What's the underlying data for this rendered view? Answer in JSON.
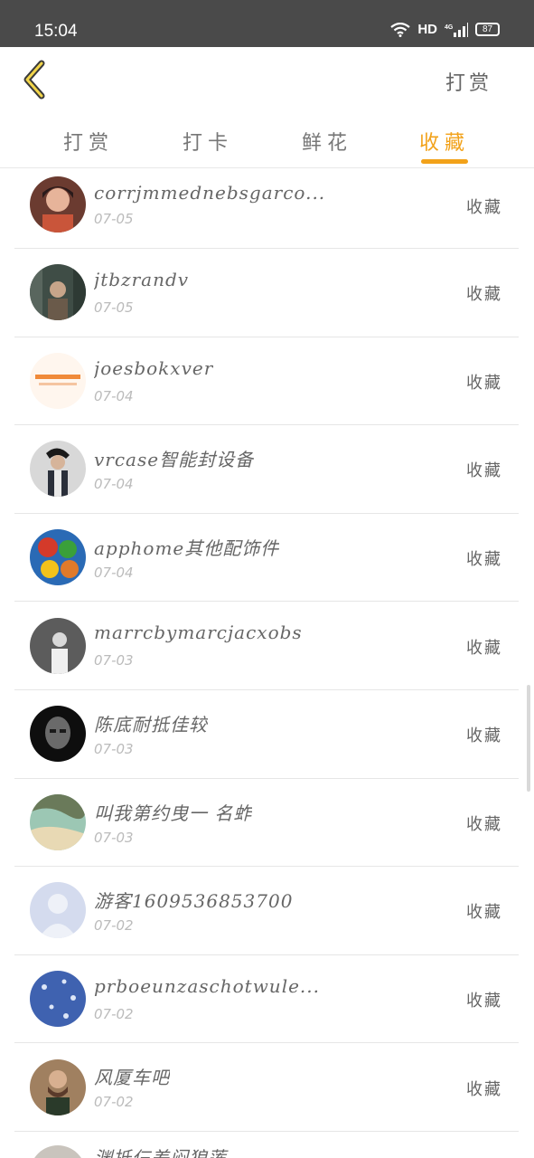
{
  "status_bar": {
    "time": "15:04",
    "network": "HD",
    "signal": "4G",
    "battery": "87"
  },
  "header": {
    "action_label": "打赏"
  },
  "tabs": [
    {
      "label": "打赏",
      "active": false
    },
    {
      "label": "打卡",
      "active": false
    },
    {
      "label": "鲜花",
      "active": false
    },
    {
      "label": "收藏",
      "active": true
    }
  ],
  "items": [
    {
      "name": "corrjmmednebsgarco...",
      "date": "07-05",
      "tag": "收藏",
      "avatar_color": "#7a4a3a"
    },
    {
      "name": "jtbzrandv",
      "date": "07-05",
      "tag": "收藏",
      "avatar_color": "#4c5a52"
    },
    {
      "name": "joesbokxver",
      "date": "07-04",
      "tag": "收藏",
      "avatar_color": "#fff4ea"
    },
    {
      "name": "vrcase智能封设备",
      "date": "07-04",
      "tag": "收藏",
      "avatar_color": "#3a3d45"
    },
    {
      "name": "apphome其他配饰件",
      "date": "07-04",
      "tag": "收藏",
      "avatar_color": "#c43a2a"
    },
    {
      "name": "marrcbymarcjacxobs",
      "date": "07-03",
      "tag": "收藏",
      "avatar_color": "#5e5e5e"
    },
    {
      "name": "陈底耐抵佳较",
      "date": "07-03",
      "tag": "收藏",
      "avatar_color": "#1c1c1c"
    },
    {
      "name": "叫我第约曳一 名蚱",
      "date": "07-03",
      "tag": "收藏",
      "avatar_color": "#8fbba4"
    },
    {
      "name": "游客1609536853700",
      "date": "07-02",
      "tag": "收藏",
      "avatar_color": "#c9d0e6"
    },
    {
      "name": "prboeunzaschotwule...",
      "date": "07-02",
      "tag": "收藏",
      "avatar_color": "#4a6bb5"
    },
    {
      "name": "风厦车吧",
      "date": "07-02",
      "tag": "收藏",
      "avatar_color": "#8a6a4a"
    }
  ],
  "partial_item": {
    "name": "渊抵仨差闷狼莲"
  }
}
